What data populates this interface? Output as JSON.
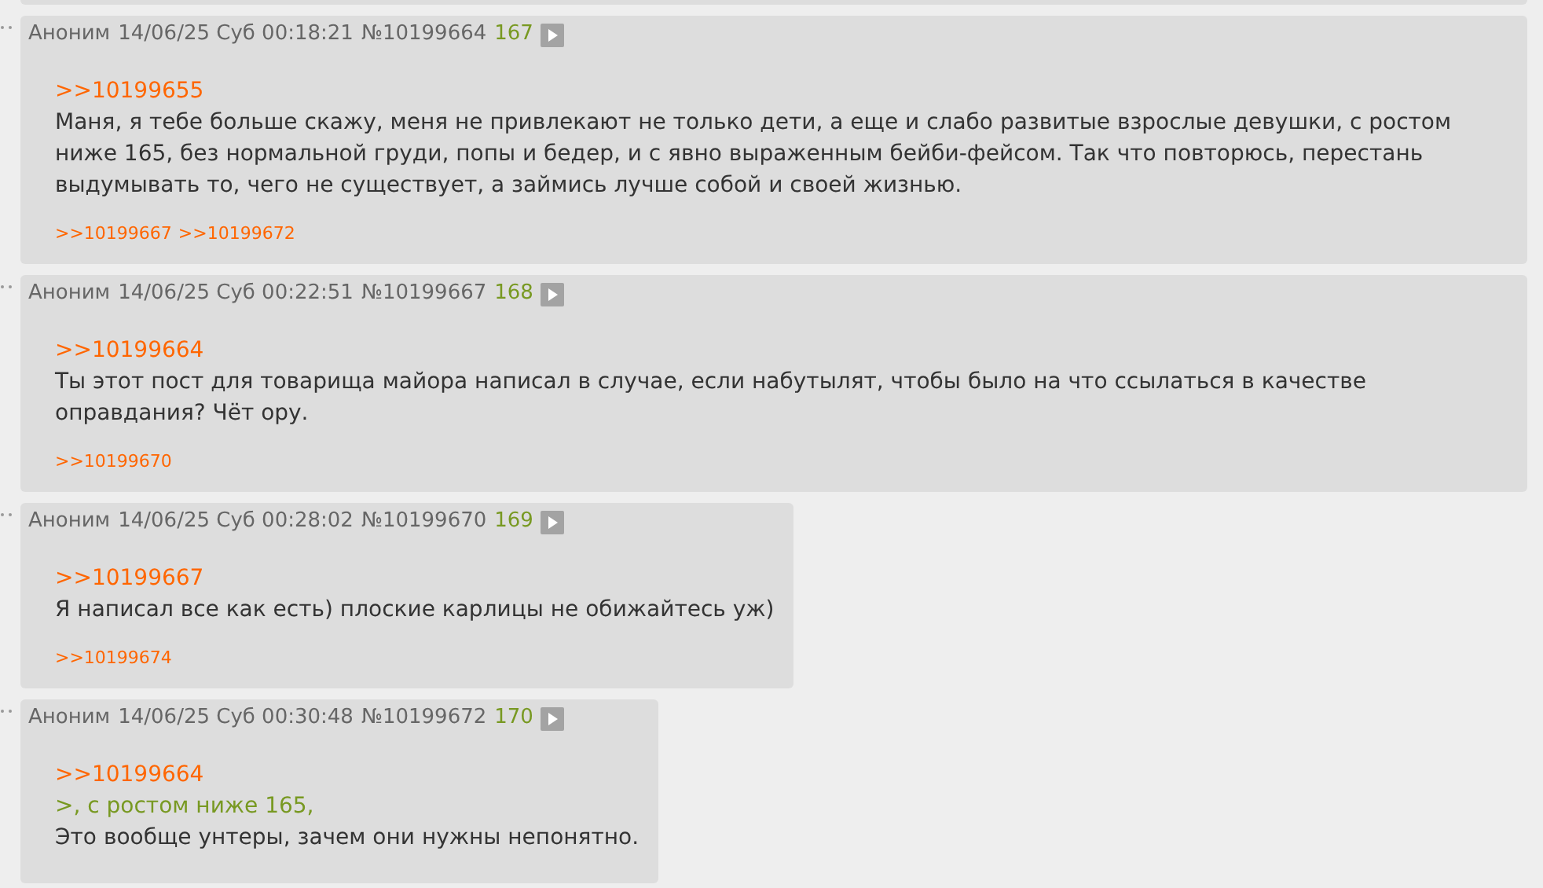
{
  "posts": [
    {
      "author": "Аноним",
      "date": "14/06/25 Суб 00:18:21",
      "number": "№10199664",
      "ordinal": "167",
      "body": [
        {
          "kind": "link",
          "text": ">>10199655"
        },
        {
          "kind": "text",
          "text": "Маня, я тебе больше скажу, меня не привлекают не только дети, а еще и слабо развитые взрослые девушки, с ростом ниже 165, без нормальной груди, попы и бедер, и с явно выраженным бейби-фейсом. Так что повторюсь, перестань выдумывать то, чего не существует, а займись лучше собой и своей жизнью."
        }
      ],
      "replies": [
        ">>10199667",
        ">>10199672"
      ]
    },
    {
      "author": "Аноним",
      "date": "14/06/25 Суб 00:22:51",
      "number": "№10199667",
      "ordinal": "168",
      "body": [
        {
          "kind": "link",
          "text": ">>10199664"
        },
        {
          "kind": "text",
          "text": "Ты этот пост для товарища майора написал в случае, если набутылят, чтобы было на что ссылаться в качестве оправдания? Чёт ору."
        }
      ],
      "replies": [
        ">>10199670"
      ]
    },
    {
      "author": "Аноним",
      "date": "14/06/25 Суб 00:28:02",
      "number": "№10199670",
      "ordinal": "169",
      "body": [
        {
          "kind": "link",
          "text": ">>10199667"
        },
        {
          "kind": "text",
          "text": "Я написал все как есть) плоские карлицы не обижайтесь уж)"
        }
      ],
      "replies": [
        ">>10199674"
      ]
    },
    {
      "author": "Аноним",
      "date": "14/06/25 Суб 00:30:48",
      "number": "№10199672",
      "ordinal": "170",
      "body": [
        {
          "kind": "link",
          "text": ">>10199664"
        },
        {
          "kind": "quote",
          "text": ">, с ростом ниже 165,"
        },
        {
          "kind": "text",
          "text": "Это вообще унтеры, зачем они нужны непонятно."
        }
      ]
    }
  ]
}
